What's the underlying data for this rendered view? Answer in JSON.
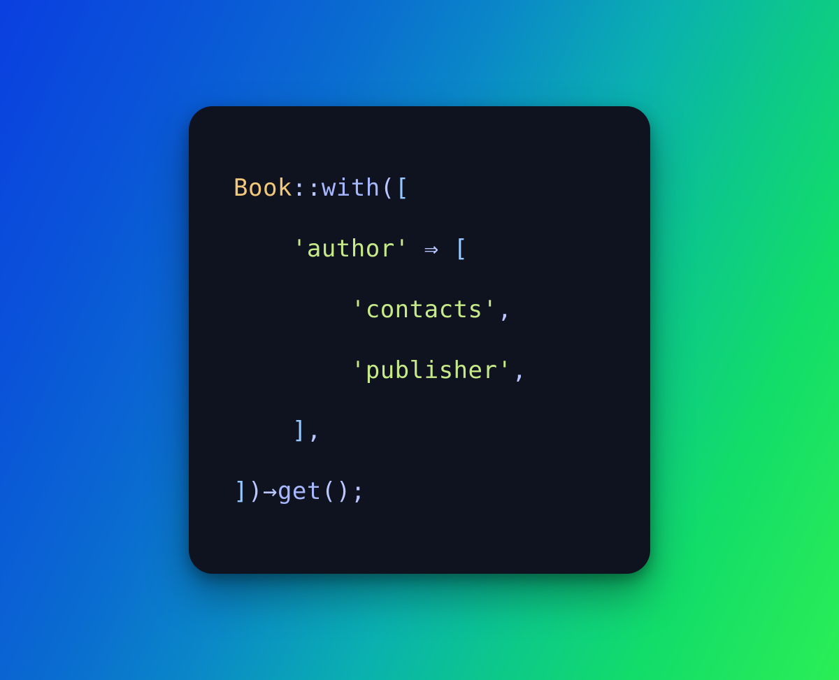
{
  "code": {
    "class": "Book",
    "scope": "::",
    "withMethod": "with",
    "openParen": "(",
    "openBracket1": "[",
    "authorKey": "'author'",
    "fatArrow": " ⇒ ",
    "openBracket2": "[",
    "contacts": "'contacts'",
    "comma1": ",",
    "publisher": "'publisher'",
    "comma2": ",",
    "closeBracket2": "]",
    "comma3": ",",
    "closeBracket1": "]",
    "closeParen": ")",
    "chainArrow": "→",
    "getMethod": "get",
    "callParens": "()",
    "semicolon": ";",
    "indent1": "    ",
    "indent2": "        "
  }
}
